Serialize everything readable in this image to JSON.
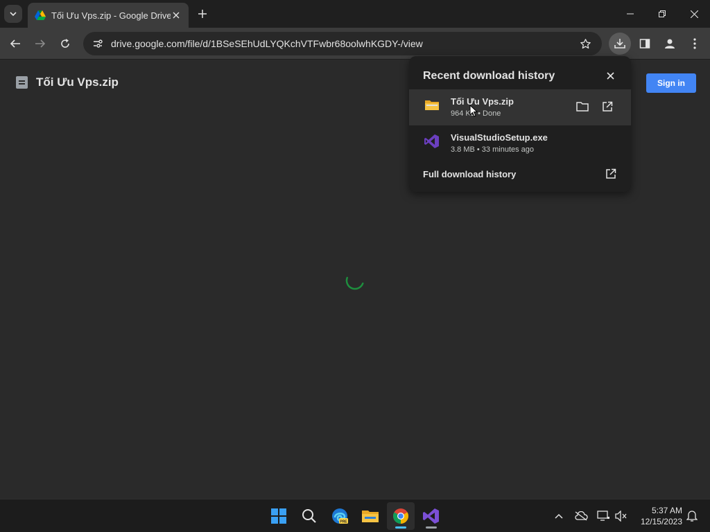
{
  "browser": {
    "tab": {
      "title": "Tối Ưu Vps.zip - Google Drive",
      "favicon": "google-drive-icon"
    },
    "url": "drive.google.com/file/d/1BSeSEhUdLYQKchVTFwbr68oolwhKGDY-/view"
  },
  "page": {
    "file_title": "Tối Ưu Vps.zip",
    "signin_label": "Sign in"
  },
  "downloads": {
    "header": "Recent download history",
    "items": [
      {
        "name": "Tối Ưu Vps.zip",
        "meta": "964 KB • Done",
        "icon": "folder-zip-icon"
      },
      {
        "name": "VisualStudioSetup.exe",
        "meta": "3.8 MB • 33 minutes ago",
        "icon": "visual-studio-icon"
      }
    ],
    "full_history_label": "Full download history"
  },
  "taskbar": {
    "time": "5:37 AM",
    "date": "12/15/2023"
  },
  "colors": {
    "accent_blue": "#4285f4",
    "spinner_green": "#1e8e3e",
    "taskbar_active": "#4cc2ff"
  }
}
